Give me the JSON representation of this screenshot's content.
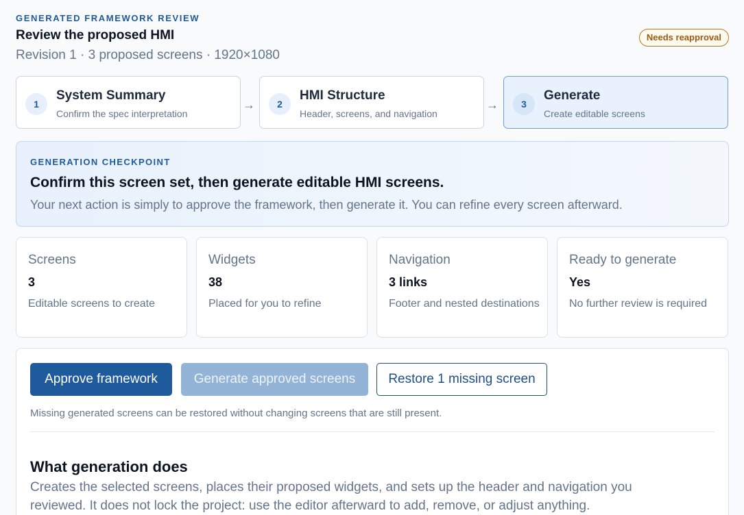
{
  "header": {
    "eyebrow": "GENERATED FRAMEWORK REVIEW",
    "title": "Review the proposed HMI",
    "subtitle": "Revision 1 · 3 proposed screens · 1920×1080",
    "badge": "Needs reapproval"
  },
  "steps": [
    {
      "number": "1",
      "title": "System Summary",
      "subtitle": "Confirm the spec interpretation"
    },
    {
      "number": "2",
      "title": "HMI Structure",
      "subtitle": "Header, screens, and navigation"
    },
    {
      "number": "3",
      "title": "Generate",
      "subtitle": "Create editable screens"
    }
  ],
  "arrow_glyph": "→",
  "checkpoint": {
    "eyebrow": "GENERATION CHECKPOINT",
    "title": "Confirm this screen set, then generate editable HMI screens.",
    "description": "Your next action is simply to approve the framework, then generate it. You can refine every screen afterward."
  },
  "stats": [
    {
      "label": "Screens",
      "value": "3",
      "description": "Editable screens to create"
    },
    {
      "label": "Widgets",
      "value": "38",
      "description": "Placed for you to refine"
    },
    {
      "label": "Navigation",
      "value": "3 links",
      "description": "Footer and nested destinations"
    },
    {
      "label": "Ready to generate",
      "value": "Yes",
      "description": "No further review is required"
    }
  ],
  "actions": {
    "approve_label": "Approve framework",
    "generate_label": "Generate approved screens",
    "restore_label": "Restore 1 missing screen",
    "note": "Missing generated screens can be restored without changing screens that are still present."
  },
  "info": {
    "title": "What generation does",
    "body": "Creates the selected screens, places their proposed widgets, and sets up the header and navigation you reviewed. It does not lock the project: use the editor afterward to add, remove, or adjust anything."
  },
  "colors": {
    "accent": "#1e5a9c",
    "badge": "#b7791f",
    "disabled": "#93b4d6"
  }
}
